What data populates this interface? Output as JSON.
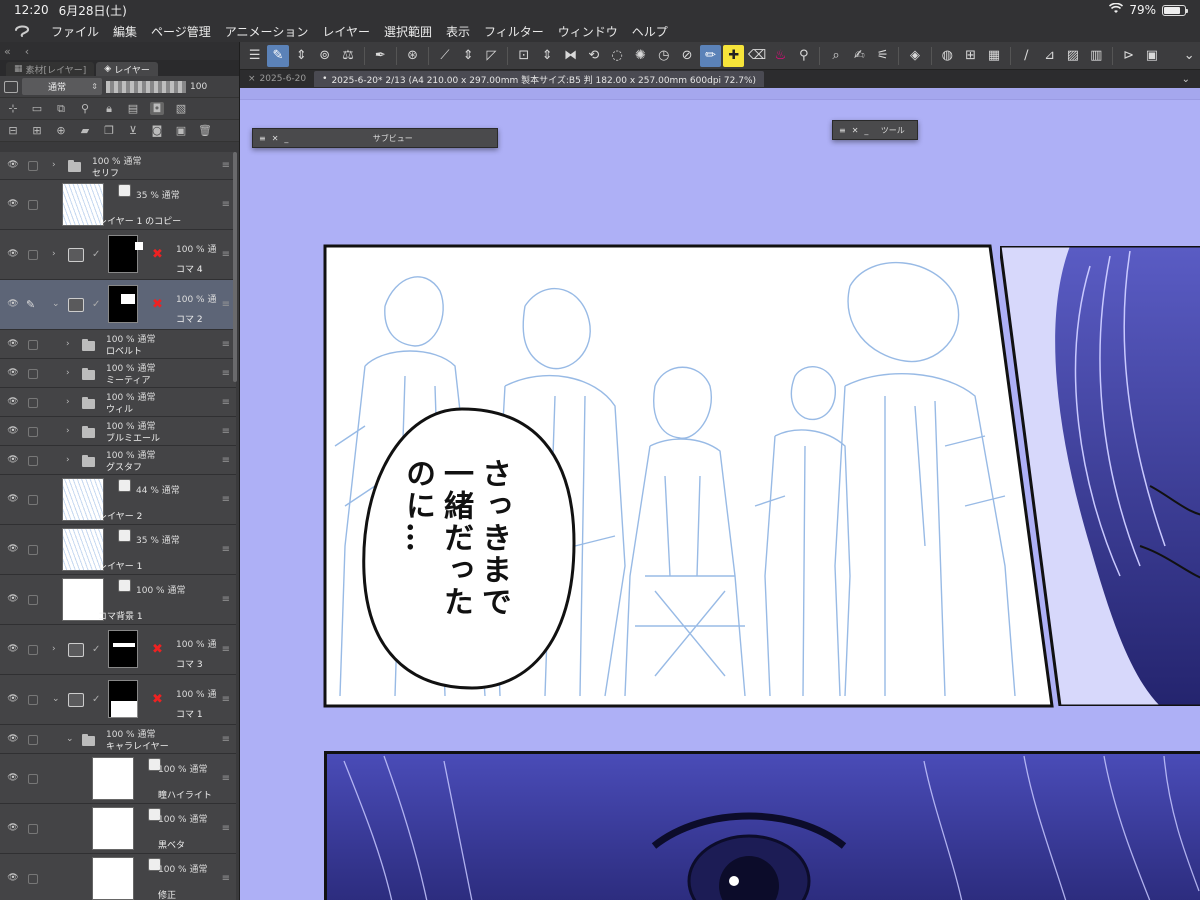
{
  "status": {
    "time": "12:20",
    "date": "6月28日(土)",
    "battery": "79%",
    "battery_level": 0.79
  },
  "menu": [
    "ファイル",
    "編集",
    "ページ管理",
    "アニメーション",
    "レイヤー",
    "選択範囲",
    "表示",
    "フィルター",
    "ウィンドウ",
    "ヘルプ"
  ],
  "left_panel": {
    "tabs": [
      "素材[レイヤー]",
      "レイヤー"
    ],
    "blend_mode": "通常",
    "opacity": "100"
  },
  "layers": [
    {
      "pct": "100 % 通常",
      "name": "セリフ"
    },
    {
      "pct": "35 % 通常",
      "name": "レイヤー 1 のコピー"
    },
    {
      "pct": "100 % 通",
      "name": "コマ 4"
    },
    {
      "pct": "100 % 通",
      "name": "コマ 2"
    },
    {
      "pct": "100 % 通常",
      "name": "ロベルト"
    },
    {
      "pct": "100 % 通常",
      "name": "ミーティア"
    },
    {
      "pct": "100 % 通常",
      "name": "ウィル"
    },
    {
      "pct": "100 % 通常",
      "name": "ブルミエール"
    },
    {
      "pct": "100 % 通常",
      "name": "グスタフ"
    },
    {
      "pct": "44 % 通常",
      "name": "レイヤー 2"
    },
    {
      "pct": "35 % 通常",
      "name": "レイヤー 1"
    },
    {
      "pct": "100 % 通常",
      "name": "コマ背景 1"
    },
    {
      "pct": "100 % 通",
      "name": "コマ 3"
    },
    {
      "pct": "100 % 通",
      "name": "コマ 1"
    },
    {
      "pct": "100 % 通常",
      "name": "キャラレイヤー"
    },
    {
      "pct": "100 % 通常",
      "name": "瞳ハイライト"
    },
    {
      "pct": "100 % 通常",
      "name": "黒ベタ"
    },
    {
      "pct": "100 % 通常",
      "name": "修正"
    }
  ],
  "doc_tabs": [
    "2025-6-20",
    "2025-6-20* 2/13 (A4 210.00 x 297.00mm 製本サイズ:B5 判 182.00 x 257.00mm 600dpi 72.7%)"
  ],
  "float_panels": {
    "subview": "サブビュー",
    "tool": "ツール"
  },
  "speech": {
    "line1": "さっきまで",
    "line2": "一緒だった",
    "line3": "のに…"
  },
  "colors": {
    "canvas_bg": "#aeb0f6",
    "panel_ink": "#1a1a5a",
    "accent": "#5b82b8"
  }
}
